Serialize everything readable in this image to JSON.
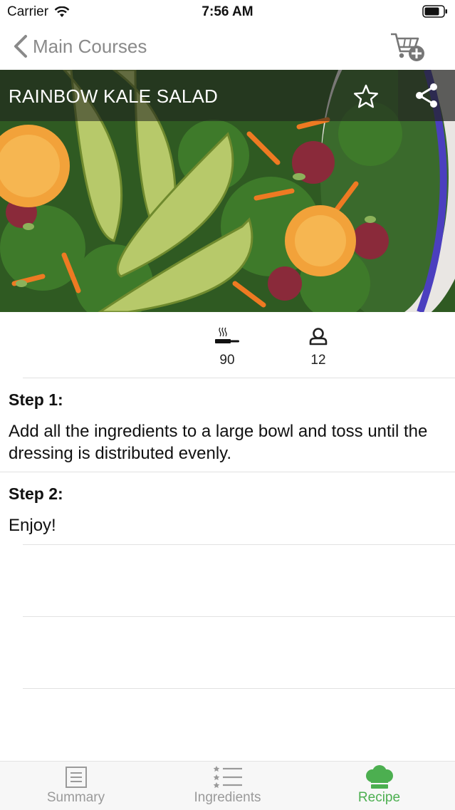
{
  "status_bar": {
    "carrier": "Carrier",
    "time": "7:56 AM"
  },
  "nav": {
    "back_label": "Main Courses"
  },
  "recipe": {
    "title": "RAINBOW KALE SALAD"
  },
  "meta": {
    "cook_time": "90",
    "servings": "12"
  },
  "steps": [
    {
      "heading": "Step 1:",
      "text": " Add all the ingredients to a large bowl and toss until the dressing is distributed evenly."
    },
    {
      "heading": "Step 2:",
      "text": " Enjoy!"
    }
  ],
  "tabs": [
    {
      "label": "Summary",
      "icon": "document-icon",
      "active": false
    },
    {
      "label": "Ingredients",
      "icon": "list-icon",
      "active": false
    },
    {
      "label": "Recipe",
      "icon": "chef-hat-icon",
      "active": true
    }
  ],
  "colors": {
    "accent": "#4caf50",
    "inactive_tab": "#9a9a9a",
    "nav_text": "#8a8a8a"
  }
}
